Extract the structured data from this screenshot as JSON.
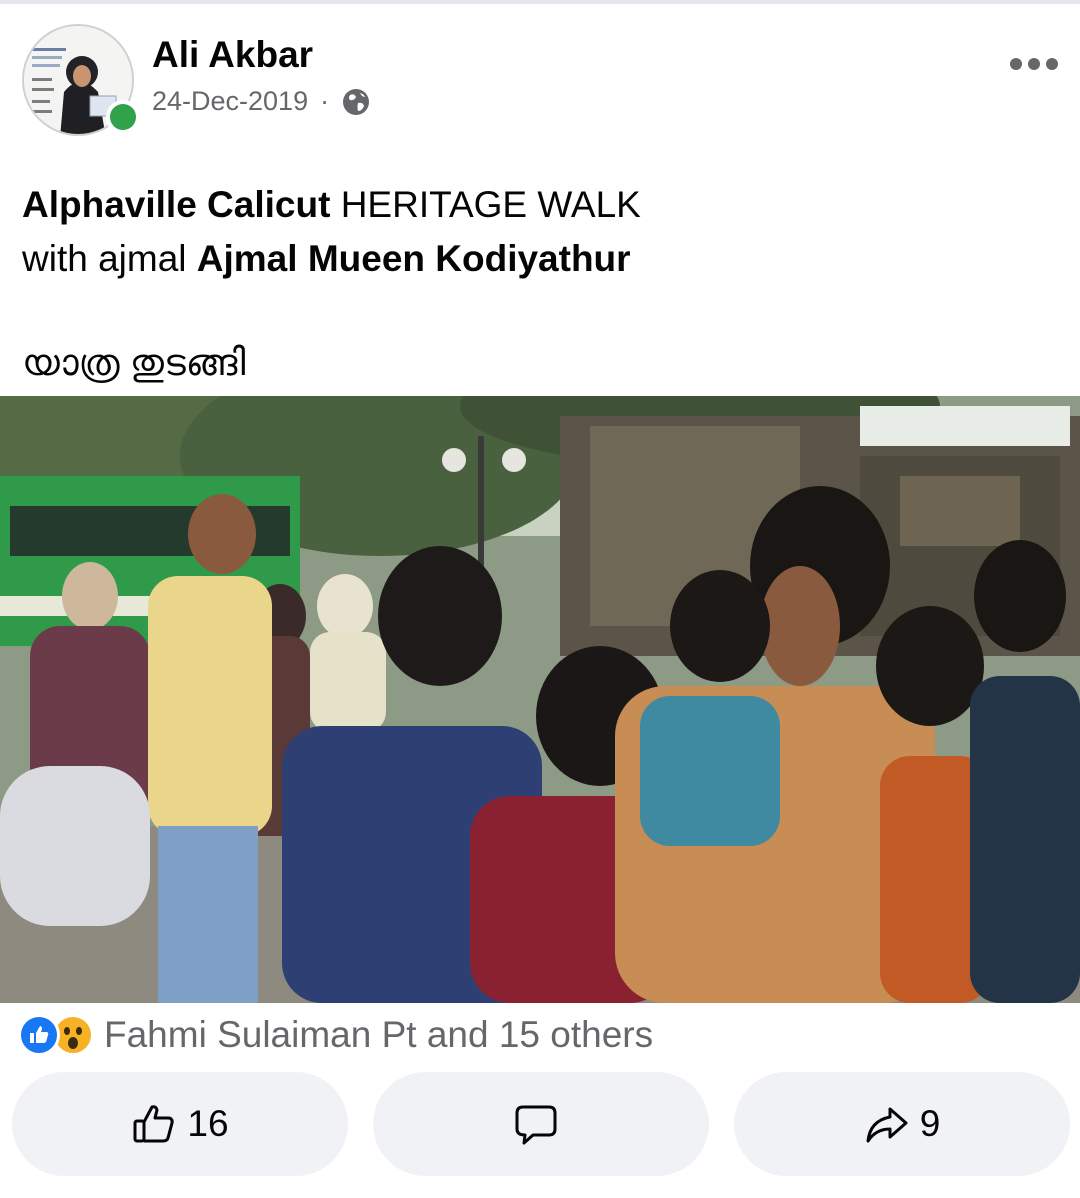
{
  "post": {
    "author": "Ali Akbar",
    "date": "24-Dec-2019",
    "separator": "·",
    "privacy_icon": "globe-icon",
    "text_line1_bold": "Alphaville Calicut",
    "text_line1_rest": " HERITAGE WALK",
    "text_line2_prefix": "with ajmal ",
    "text_line2_bold": "Ajmal Mueen Kodiyathur",
    "text_malayalam": "യാത്ര തുടങ്ങി"
  },
  "reactions": {
    "icons": [
      "like-icon",
      "wow-icon"
    ],
    "summary": "Fahmi Sulaiman Pt and 15 others"
  },
  "actions": {
    "like_count": "16",
    "comment_count": "",
    "share_count": "9"
  },
  "colors": {
    "accent": "#1877f2",
    "online": "#31a24c",
    "muted_text": "#65676b",
    "button_bg": "#f0f2f5"
  }
}
